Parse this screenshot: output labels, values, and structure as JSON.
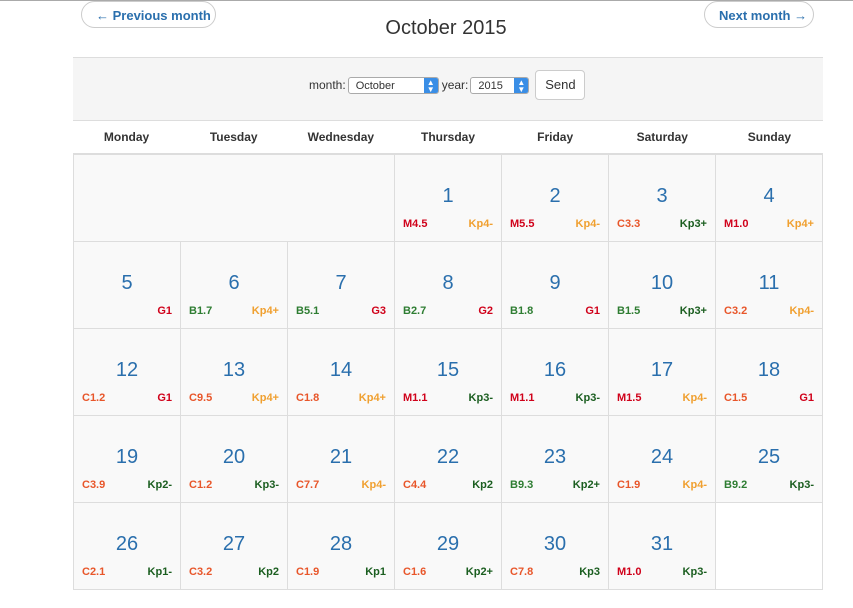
{
  "nav": {
    "prev_label": "← Previous month",
    "next_label": "Next month →"
  },
  "title": "October 2015",
  "form": {
    "month_label": "month:",
    "month_value": "October",
    "year_label": "year:",
    "year_value": "2015",
    "send_label": "Send"
  },
  "weekdays": [
    "Monday",
    "Tuesday",
    "Wednesday",
    "Thursday",
    "Friday",
    "Saturday",
    "Sunday"
  ],
  "leading_blank_days": 3,
  "colors": {
    "M": "#d0021b",
    "C": "#e8562a",
    "B": "#2e7d32",
    "G": "#d0021b",
    "Kp4": "#f0a030",
    "Kp": "#1b5e20",
    "day": "#2a6fad"
  },
  "days": [
    {
      "day": 1,
      "flare": "M4.5",
      "kp": "Kp4-"
    },
    {
      "day": 2,
      "flare": "M5.5",
      "kp": "Kp4-"
    },
    {
      "day": 3,
      "flare": "C3.3",
      "kp": "Kp3+"
    },
    {
      "day": 4,
      "flare": "M1.0",
      "kp": "Kp4+"
    },
    {
      "day": 5,
      "flare": "",
      "kp": "G1"
    },
    {
      "day": 6,
      "flare": "B1.7",
      "kp": "Kp4+"
    },
    {
      "day": 7,
      "flare": "B5.1",
      "kp": "G3"
    },
    {
      "day": 8,
      "flare": "B2.7",
      "kp": "G2"
    },
    {
      "day": 9,
      "flare": "B1.8",
      "kp": "G1"
    },
    {
      "day": 10,
      "flare": "B1.5",
      "kp": "Kp3+"
    },
    {
      "day": 11,
      "flare": "C3.2",
      "kp": "Kp4-"
    },
    {
      "day": 12,
      "flare": "C1.2",
      "kp": "G1"
    },
    {
      "day": 13,
      "flare": "C9.5",
      "kp": "Kp4+"
    },
    {
      "day": 14,
      "flare": "C1.8",
      "kp": "Kp4+"
    },
    {
      "day": 15,
      "flare": "M1.1",
      "kp": "Kp3-"
    },
    {
      "day": 16,
      "flare": "M1.1",
      "kp": "Kp3-"
    },
    {
      "day": 17,
      "flare": "M1.5",
      "kp": "Kp4-"
    },
    {
      "day": 18,
      "flare": "C1.5",
      "kp": "G1"
    },
    {
      "day": 19,
      "flare": "C3.9",
      "kp": "Kp2-"
    },
    {
      "day": 20,
      "flare": "C1.2",
      "kp": "Kp3-"
    },
    {
      "day": 21,
      "flare": "C7.7",
      "kp": "Kp4-"
    },
    {
      "day": 22,
      "flare": "C4.4",
      "kp": "Kp2"
    },
    {
      "day": 23,
      "flare": "B9.3",
      "kp": "Kp2+"
    },
    {
      "day": 24,
      "flare": "C1.9",
      "kp": "Kp4-"
    },
    {
      "day": 25,
      "flare": "B9.2",
      "kp": "Kp3-"
    },
    {
      "day": 26,
      "flare": "C2.1",
      "kp": "Kp1-"
    },
    {
      "day": 27,
      "flare": "C3.2",
      "kp": "Kp2"
    },
    {
      "day": 28,
      "flare": "C1.9",
      "kp": "Kp1"
    },
    {
      "day": 29,
      "flare": "C1.6",
      "kp": "Kp2+"
    },
    {
      "day": 30,
      "flare": "C7.8",
      "kp": "Kp3"
    },
    {
      "day": 31,
      "flare": "M1.0",
      "kp": "Kp3-"
    }
  ]
}
